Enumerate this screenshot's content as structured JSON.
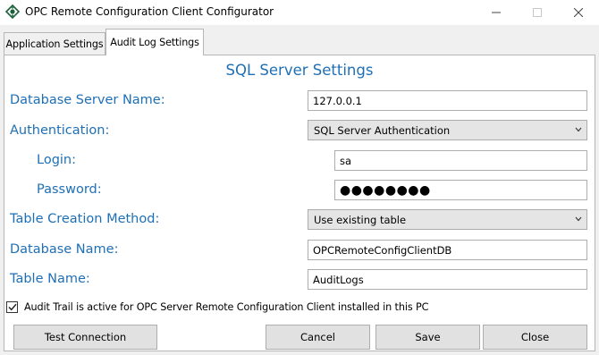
{
  "window": {
    "title": "OPC Remote Configuration Client Configurator",
    "icon": "opc-app-icon",
    "controls": [
      "minimize-icon",
      "maximize-icon",
      "close-icon"
    ]
  },
  "tabs": [
    {
      "label": "Application Settings",
      "active": false
    },
    {
      "label": "Audit Log Settings",
      "active": true
    }
  ],
  "section": {
    "title": "SQL Server Settings"
  },
  "form": {
    "server_name": {
      "label": "Database Server Name:",
      "value": "127.0.0.1"
    },
    "authentication": {
      "label": "Authentication:",
      "selected": "SQL Server Authentication"
    },
    "login": {
      "label": "Login:",
      "value": "sa"
    },
    "password": {
      "label": "Password:",
      "value": "●●●●●●●●"
    },
    "table_creation": {
      "label": "Table Creation Method:",
      "selected": "Use existing table"
    },
    "database_name": {
      "label": "Database Name:",
      "value": "OPCRemoteConfigClientDB"
    },
    "table_name": {
      "label": "Table Name:",
      "value": "AuditLogs"
    }
  },
  "audit_trail": {
    "checked": true,
    "label": "Audit Trail is active for OPC Server Remote Configuration Client installed in this PC"
  },
  "buttons": {
    "test_connection": "Test Connection",
    "cancel": "Cancel",
    "save": "Save",
    "close": "Close"
  },
  "colors": {
    "label_blue": "#1f6fb5",
    "window_bg": "#f0f0f0",
    "panel_bg": "#ffffff",
    "button_bg": "#e1e1e1"
  }
}
